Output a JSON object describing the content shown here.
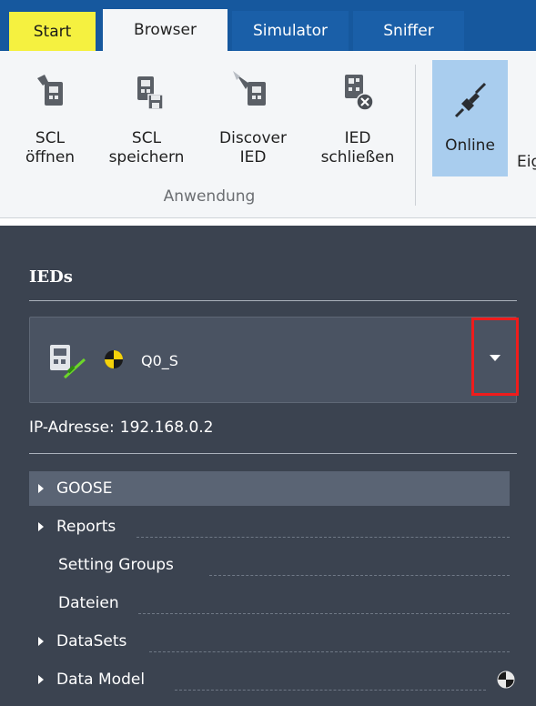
{
  "tabs": [
    {
      "label": "Start",
      "active": false
    },
    {
      "label": "Browser",
      "active": true
    },
    {
      "label": "Simulator",
      "active": false
    },
    {
      "label": "Sniffer",
      "active": false
    }
  ],
  "ribbon": {
    "group_label": "Anwendung",
    "buttons": [
      {
        "line1": "SCL",
        "line2": "öffnen",
        "icon": "scl-open-icon"
      },
      {
        "line1": "SCL",
        "line2": "speichern",
        "icon": "scl-save-icon"
      },
      {
        "line1": "Discover",
        "line2": "IED",
        "icon": "discover-ied-icon"
      },
      {
        "line1": "IED",
        "line2": "schließen",
        "icon": "ied-close-icon"
      }
    ],
    "online_label": "Online",
    "cut_label": "Eig"
  },
  "panel": {
    "title": "IEDs",
    "selected_ied": "Q0_S",
    "ip_label": "IP-Adresse:",
    "ip_value": "192.168.0.2",
    "tree": [
      {
        "label": "GOOSE",
        "expandable": true,
        "selected": true
      },
      {
        "label": "Reports",
        "expandable": true,
        "selected": false
      },
      {
        "label": "Setting Groups",
        "expandable": false,
        "selected": false
      },
      {
        "label": "Dateien",
        "expandable": false,
        "selected": false
      },
      {
        "label": "DataSets",
        "expandable": true,
        "selected": false
      },
      {
        "label": "Data Model",
        "expandable": true,
        "selected": false
      }
    ]
  },
  "colors": {
    "tab_bar": "#16589e",
    "start_tab": "#f5f140",
    "panel_bg": "#3b4350",
    "online_highlight": "#a9cdee",
    "highlight_box": "#ef1c1c"
  }
}
